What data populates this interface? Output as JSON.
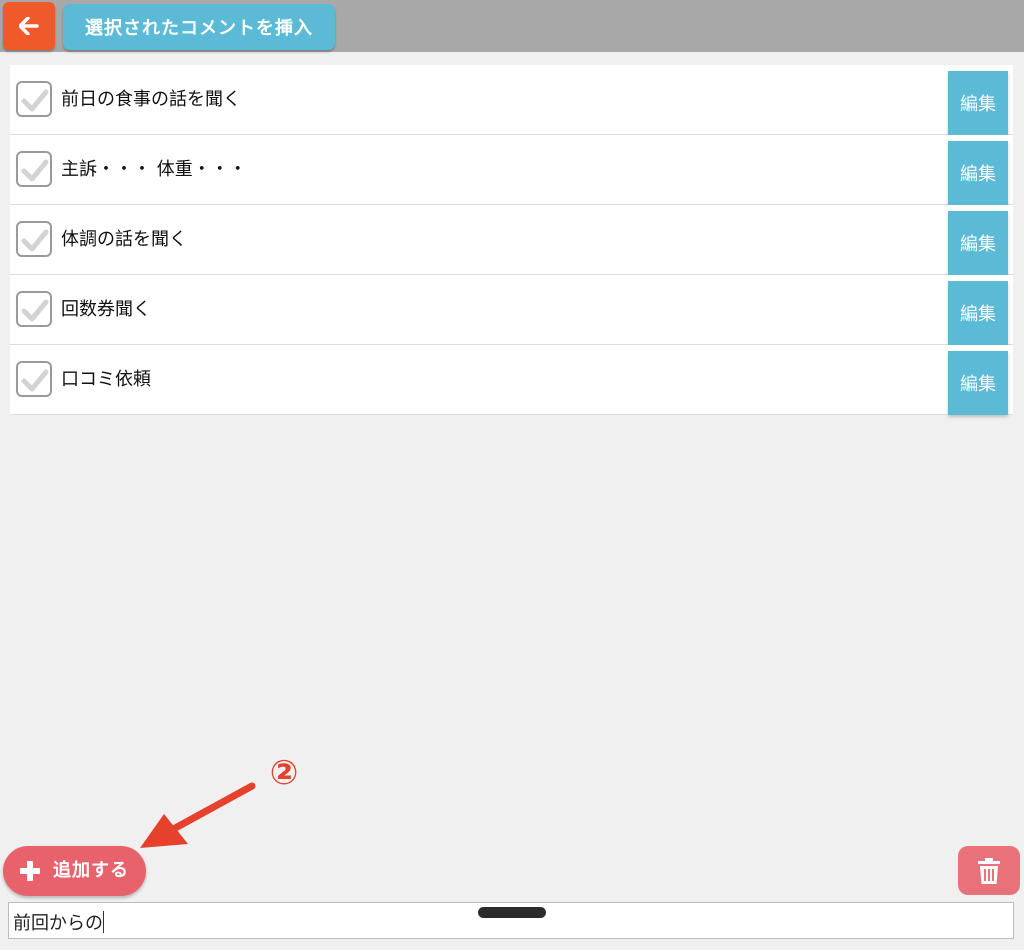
{
  "header": {
    "back_icon": "arrow-left-icon",
    "insert_label": "選択されたコメントを挿入",
    "colors": {
      "bar": "#a9a8a9",
      "back": "#f05a2a",
      "accent": "#5bbad5"
    }
  },
  "comments": {
    "edit_label": "編集",
    "items": [
      {
        "label": "前日の食事の話を聞く",
        "checked": false
      },
      {
        "label": "主訴・・・ 体重・・・",
        "checked": false
      },
      {
        "label": "体調の話を聞く",
        "checked": false
      },
      {
        "label": "回数券聞く",
        "checked": false
      },
      {
        "label": "口コミ依頼",
        "checked": false
      }
    ]
  },
  "annotation": {
    "number": "②",
    "color": "#e5412d"
  },
  "footer": {
    "add_label": "追加する",
    "add_icon": "plus-icon",
    "delete_icon": "trash-icon",
    "input_value": "前回からの",
    "colors": {
      "add": "#e8626c",
      "delete": "#e8727a"
    }
  }
}
